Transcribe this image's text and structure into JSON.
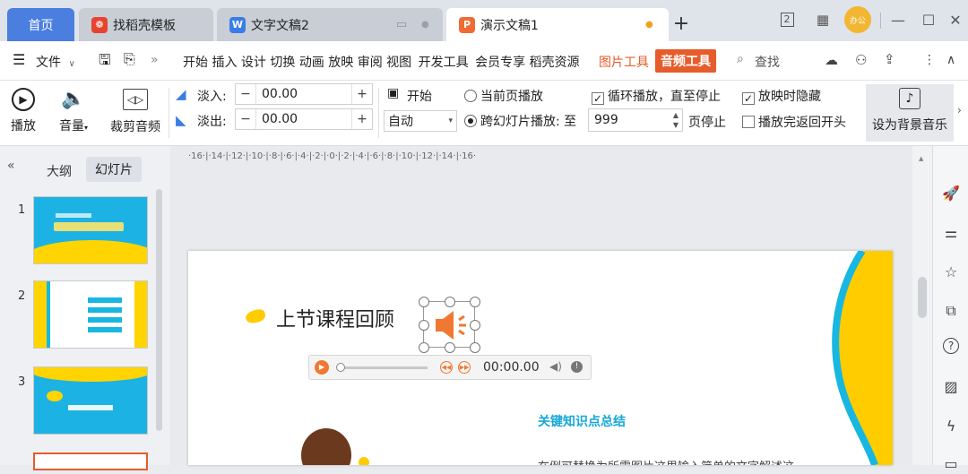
{
  "tabs": {
    "home": "首页",
    "templates": "找稻壳模板",
    "writer": "文字文稿2",
    "present": "演示文稿1",
    "new_tab": "+"
  },
  "window": {
    "layout_badge": "2",
    "user_badge": "办公"
  },
  "menu": {
    "file": "文件",
    "items": [
      "开始",
      "插入",
      "设计",
      "切换",
      "动画",
      "放映",
      "审阅",
      "视图",
      "开发工具",
      "会员专享",
      "稻壳资源"
    ],
    "picture_tools": "图片工具",
    "audio_tools": "音频工具",
    "search": "查找"
  },
  "ribbon": {
    "play": "播放",
    "volume": "音量",
    "trim": "裁剪音频",
    "fade_in_label": "淡入:",
    "fade_in_value": "00.00",
    "fade_out_label": "淡出:",
    "fade_out_value": "00.00",
    "start_label": "开始",
    "start_value": "自动",
    "current_page": "当前页播放",
    "cross_slide": "跨幻灯片播放: 至",
    "cross_value": "999",
    "page_stop": "页停止",
    "loop": "循环播放，直至停止",
    "hide_on_show": "放映时隐藏",
    "rewind": "播放完返回开头",
    "bg_music": "设为背景音乐"
  },
  "panel": {
    "outline_tab": "大纲",
    "slides_tab": "幻灯片",
    "slide_numbers": [
      "1",
      "2",
      "3"
    ]
  },
  "ruler_text": "·16·|·14·|·12·|·10·|·8·|·6·|·4·|·2·|·0·|·2·|·4·|·6·|·8·|·10·|·12·|·14·|·16·",
  "slide": {
    "title": "上节课程回顾",
    "time": "00:00.00",
    "key_points": "关键知识点总结",
    "body_text": "在例可替换为所需图片这里输入简单的文字解述这"
  },
  "colors": {
    "accent_orange": "#e65c2a",
    "slide_yellow": "#ffcc00",
    "slide_cyan": "#17b7e2",
    "audio_orange": "#f07832"
  }
}
